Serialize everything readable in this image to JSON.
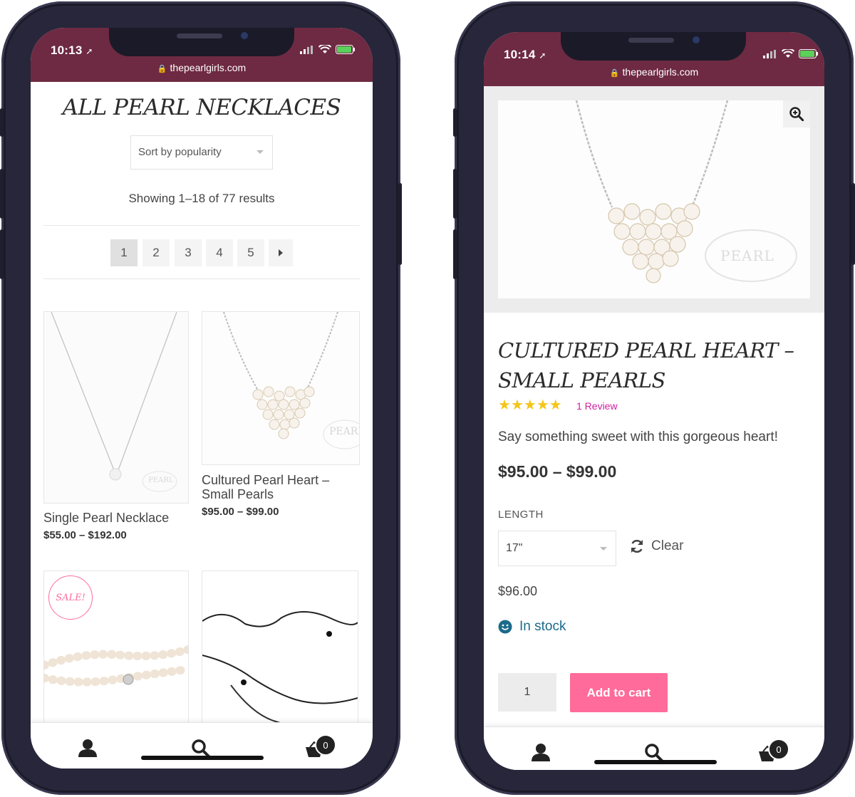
{
  "colors": {
    "brand": "#6e2a42",
    "accent": "#ff6b9a",
    "star": "#f5c518",
    "instock": "#1b6b8a",
    "review": "#d020a0"
  },
  "left_phone": {
    "status": {
      "time": "10:13",
      "url": "thepearlgirls.com"
    },
    "page_title": "ALL PEARL NECKLACES",
    "sort_select": {
      "value": "Sort by popularity"
    },
    "results_text": "Showing 1–18 of 77 results",
    "pagination": {
      "pages": [
        "1",
        "2",
        "3",
        "4",
        "5"
      ],
      "current": "1",
      "next_icon": "caret-right-icon"
    },
    "products": [
      {
        "name": "Single Pearl Necklace",
        "price": "$55.00 – $192.00"
      },
      {
        "name_line1": "Cultured Pearl Heart –",
        "name_line2": "Small Pearls",
        "price": "$95.00 – $99.00"
      }
    ],
    "sale_badge": "SALE!",
    "watermark": "PEARL",
    "cart_count": "0",
    "icons": [
      "user-icon",
      "search-icon",
      "cart-icon"
    ]
  },
  "right_phone": {
    "status": {
      "time": "10:14",
      "url": "thepearlgirls.com"
    },
    "product": {
      "title_line1": "CULTURED PEARL HEART –",
      "title_line2": "SMALL PEARLS",
      "rating_stars": 5,
      "review_link": "1 Review",
      "tagline": "Say something sweet with this gorgeous heart!",
      "price_range": "$95.00 – $99.00",
      "length_label": "LENGTH",
      "length_value": "17\"",
      "clear_label": "Clear",
      "variation_price": "$96.00",
      "stock": "In stock",
      "quantity": "1",
      "add_to_cart": "Add to cart",
      "watermark": "PEARL"
    },
    "cart_count": "0",
    "icons": [
      "zoom-icon",
      "user-icon",
      "search-icon",
      "cart-icon",
      "refresh-icon",
      "smile-icon"
    ]
  }
}
